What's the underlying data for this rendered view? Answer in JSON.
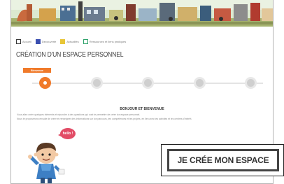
{
  "nav": {
    "items": [
      {
        "label": "Accueil",
        "color": "#3a3a3a"
      },
      {
        "label": "Découverte",
        "color": "#3b4fb0"
      },
      {
        "label": "Actualités",
        "color": "#e8c637"
      },
      {
        "label": "Ressources et liens pratiques",
        "color": "#2fa36b"
      }
    ]
  },
  "page": {
    "title": "CRÉATION D'UN ESPACE PERSONNEL",
    "active_step_label": "Bienvenue",
    "section_heading": "BONJOUR ET BIENVENUE",
    "paragraph_line1": "Vous allez créer quelques éléments et répondre à des questions qui vont te permettre de créer ton espace personnel.",
    "paragraph_line2": "Nous te proposerons ensuite de créer et renseigner des informations sur ton parcours, tes compétences et tes projets, en lien avec tes activités et tes centres d'intérêt."
  },
  "bubble": {
    "text": "hello !"
  },
  "cta": {
    "label": "JE CRÉE MON ESPACE"
  },
  "colors": {
    "accent": "#f07a2a",
    "bubble": "#e24c66"
  }
}
